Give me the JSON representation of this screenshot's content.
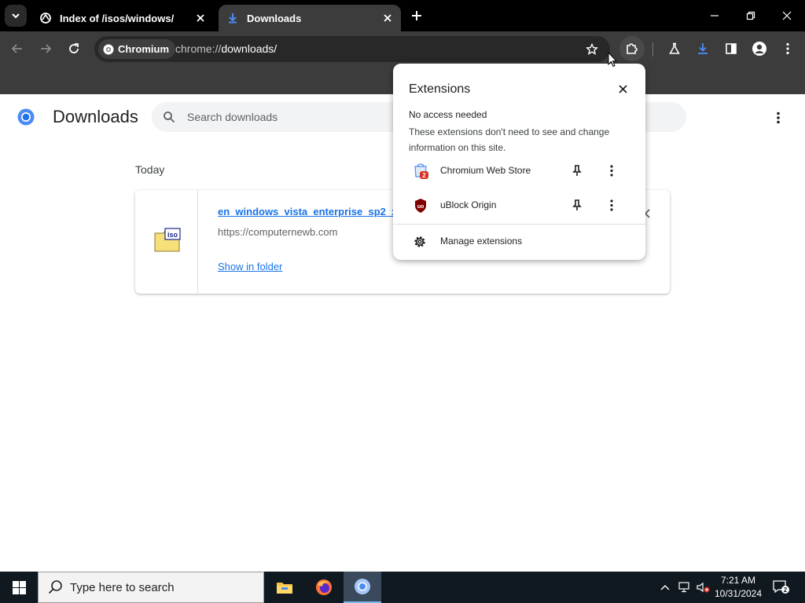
{
  "tabs": [
    {
      "title": "Index of /isos/windows/",
      "icon": "site-icon"
    },
    {
      "title": "Downloads",
      "icon": "download-icon",
      "active": true
    }
  ],
  "toolbar": {
    "chip_label": "Chromium",
    "url_scheme": "chrome://",
    "url_path": "downloads/"
  },
  "downloads_page": {
    "title": "Downloads",
    "search_placeholder": "Search downloads",
    "date_header": "Today",
    "items": [
      {
        "filename": "en_windows_vista_enterprise_sp2_x86",
        "source": "https://computernewb.com",
        "action": "Show in folder",
        "icon": "iso-file-icon"
      }
    ]
  },
  "extensions_popup": {
    "title": "Extensions",
    "section_title": "No access needed",
    "section_desc": "These extensions don't need to see and change information on this site.",
    "extensions": [
      {
        "name": "Chromium Web Store",
        "badge": "2",
        "icon": "web-store-icon"
      },
      {
        "name": "uBlock Origin",
        "icon": "ublock-icon"
      }
    ],
    "manage_label": "Manage extensions"
  },
  "taskbar": {
    "search_placeholder": "Type here to search",
    "time": "7:21 AM",
    "date": "10/31/2024",
    "notification_count": "2"
  },
  "colors": {
    "link": "#1a73e8",
    "tabstrip": "#000000",
    "toolbar": "#3c3c3c",
    "taskbar": "#101820"
  }
}
